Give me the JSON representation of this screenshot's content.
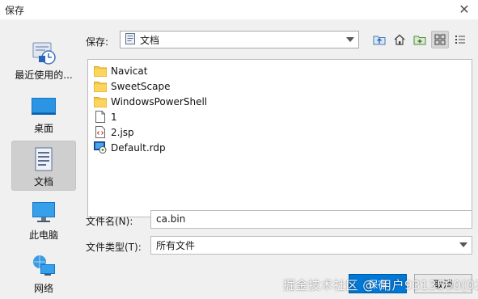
{
  "window": {
    "title": "保存",
    "close_glyph": "✕"
  },
  "places": [
    {
      "label": "最近使用的...",
      "icon": "recent-icon"
    },
    {
      "label": "桌面",
      "icon": "desktop-icon"
    },
    {
      "label": "文档",
      "icon": "documents-icon",
      "selected": true
    },
    {
      "label": "此电脑",
      "icon": "computer-icon"
    },
    {
      "label": "网络",
      "icon": "network-icon"
    }
  ],
  "save_in": {
    "label": "保存:",
    "value": "文档"
  },
  "toolbar": [
    "up-folder-icon",
    "home-icon",
    "new-folder-icon",
    "list-view-icon",
    "details-view-icon"
  ],
  "files": [
    {
      "name": "Navicat",
      "type": "folder"
    },
    {
      "name": "SweetScape",
      "type": "folder"
    },
    {
      "name": "WindowsPowerShell",
      "type": "folder"
    },
    {
      "name": "1",
      "type": "file"
    },
    {
      "name": "2.jsp",
      "type": "jsp"
    },
    {
      "name": "Default.rdp",
      "type": "rdp"
    }
  ],
  "filename": {
    "label": "文件名(N):",
    "value": "ca.bin"
  },
  "filetype": {
    "label": "文件类型(T):",
    "value": "所有文件"
  },
  "buttons": {
    "save": "保存",
    "cancel": "取消"
  },
  "watermark": "掘金技术社区 @ 用户9313560(0274",
  "colors": {
    "accent": "#0078d7",
    "folder": "#f7c843",
    "selected_place": "#cfcfcf"
  }
}
